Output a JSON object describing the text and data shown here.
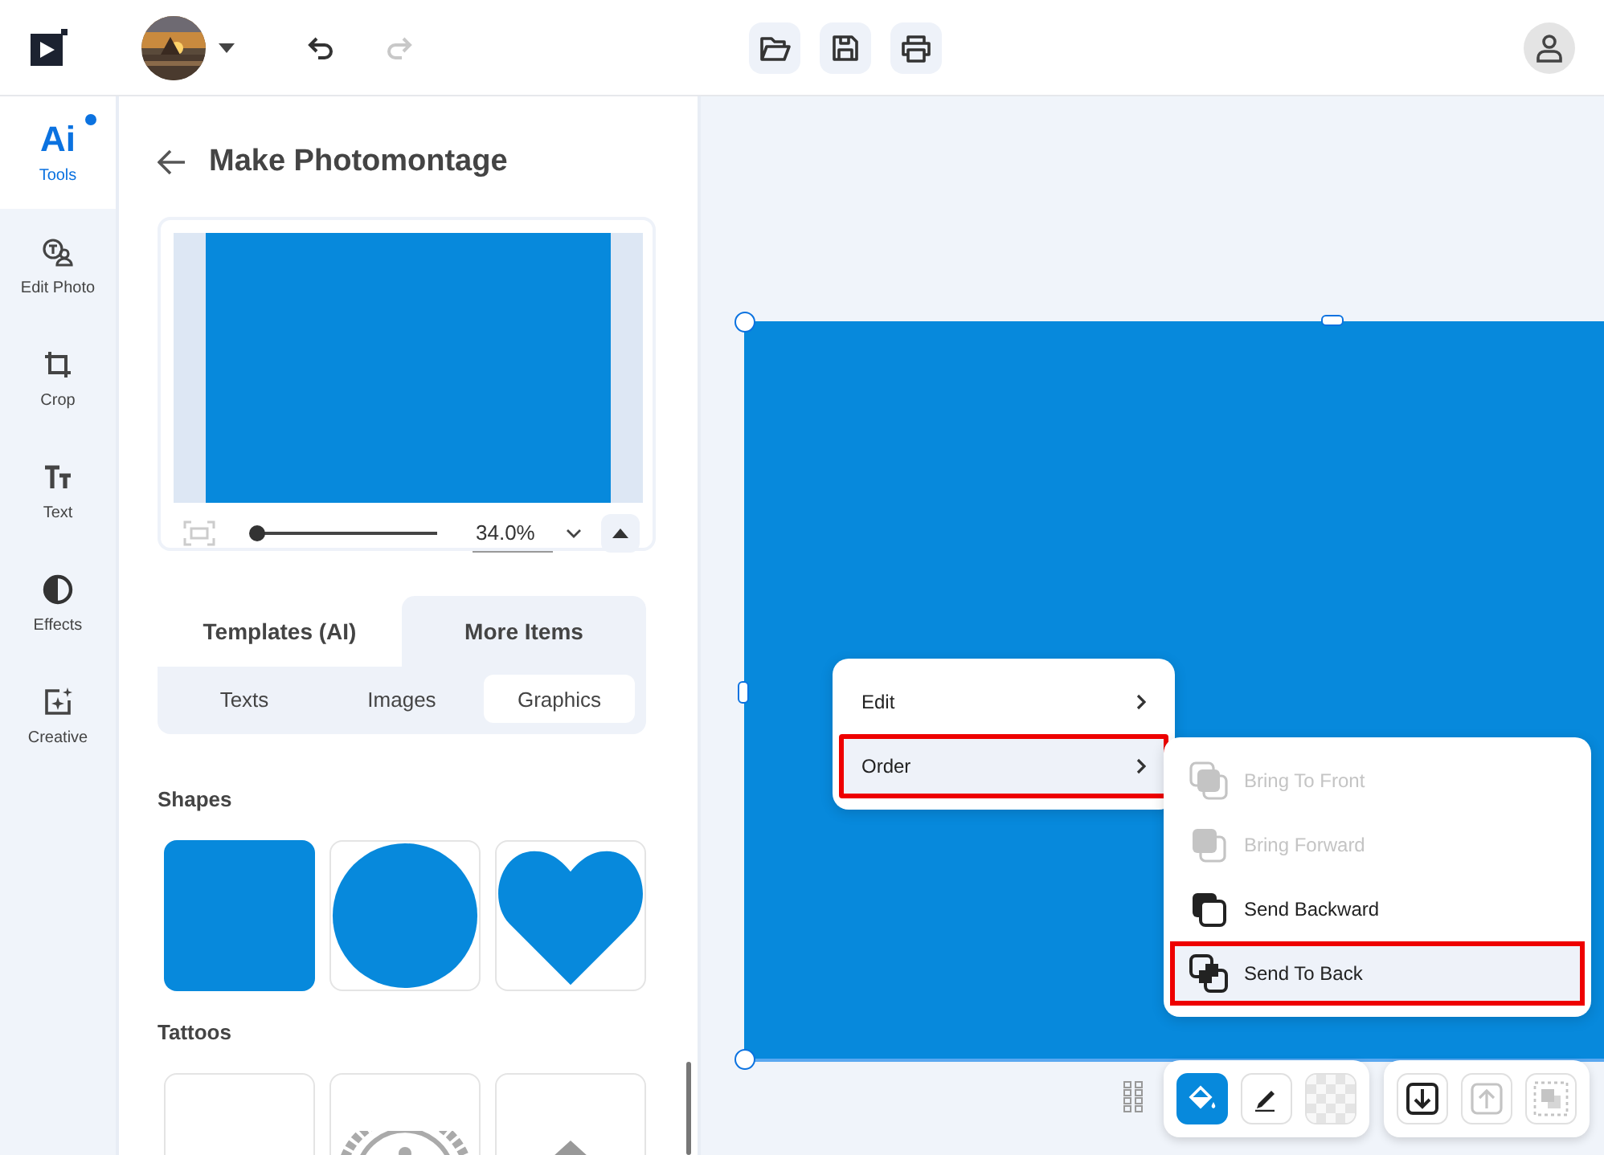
{
  "top_bar": {
    "undo": {
      "disabled": false
    },
    "redo": {
      "disabled": true
    },
    "file_actions": [
      {
        "kind": "open"
      },
      {
        "kind": "save"
      },
      {
        "kind": "print"
      }
    ]
  },
  "rail": [
    {
      "kind": "ai",
      "icon_text": "Ai",
      "label": "Tools",
      "selected": true,
      "badge": true
    },
    {
      "kind": "edit",
      "label": "Edit Photo",
      "selected": false,
      "badge": false
    },
    {
      "kind": "crop",
      "label": "Crop",
      "selected": false,
      "badge": false
    },
    {
      "kind": "text",
      "label": "Text",
      "selected": false,
      "badge": false
    },
    {
      "kind": "effects",
      "label": "Effects",
      "selected": false,
      "badge": false
    },
    {
      "kind": "creative",
      "label": "Creative",
      "selected": false,
      "badge": false
    }
  ],
  "panel": {
    "title": "Make Photomontage",
    "preview": {
      "zoom": "34.0%",
      "level": 0
    },
    "tabs": [
      {
        "label": "Templates (AI)",
        "selected": false
      },
      {
        "label": "More Items",
        "selected": true
      }
    ],
    "subtabs": [
      {
        "label": "Texts",
        "selected": false
      },
      {
        "label": "Images",
        "selected": false
      },
      {
        "label": "Graphics",
        "selected": true
      }
    ],
    "sections": [
      {
        "title": "Shapes",
        "items": [
          {
            "kind": "square"
          },
          {
            "kind": "circle"
          },
          {
            "kind": "heart"
          }
        ]
      },
      {
        "title": "Tattoos",
        "items": [
          {
            "kind": "blank"
          },
          {
            "kind": "tribal"
          },
          {
            "kind": "arrow"
          }
        ]
      }
    ]
  },
  "canvas": {
    "context_menu": [
      {
        "label": "Edit",
        "highlighted": false
      },
      {
        "label": "Order",
        "highlighted": true
      }
    ],
    "submenu": [
      {
        "kind": "front",
        "label": "Bring To Front",
        "disabled": true,
        "highlighted": false
      },
      {
        "kind": "forward",
        "label": "Bring Forward",
        "disabled": true,
        "highlighted": false
      },
      {
        "kind": "backward",
        "label": "Send Backward",
        "disabled": false,
        "highlighted": false
      },
      {
        "kind": "back",
        "label": "Send To Back",
        "disabled": false,
        "highlighted": true
      }
    ],
    "toolbar": [
      [
        {
          "kind": "fill",
          "selected": true,
          "disabled": false
        },
        {
          "kind": "pen",
          "selected": false,
          "disabled": false
        },
        {
          "kind": "transparency",
          "selected": false,
          "disabled": false
        }
      ],
      [
        {
          "kind": "down",
          "selected": false,
          "disabled": false
        },
        {
          "kind": "up",
          "selected": false,
          "disabled": true
        },
        {
          "kind": "layers",
          "selected": false,
          "disabled": true
        }
      ]
    ]
  }
}
